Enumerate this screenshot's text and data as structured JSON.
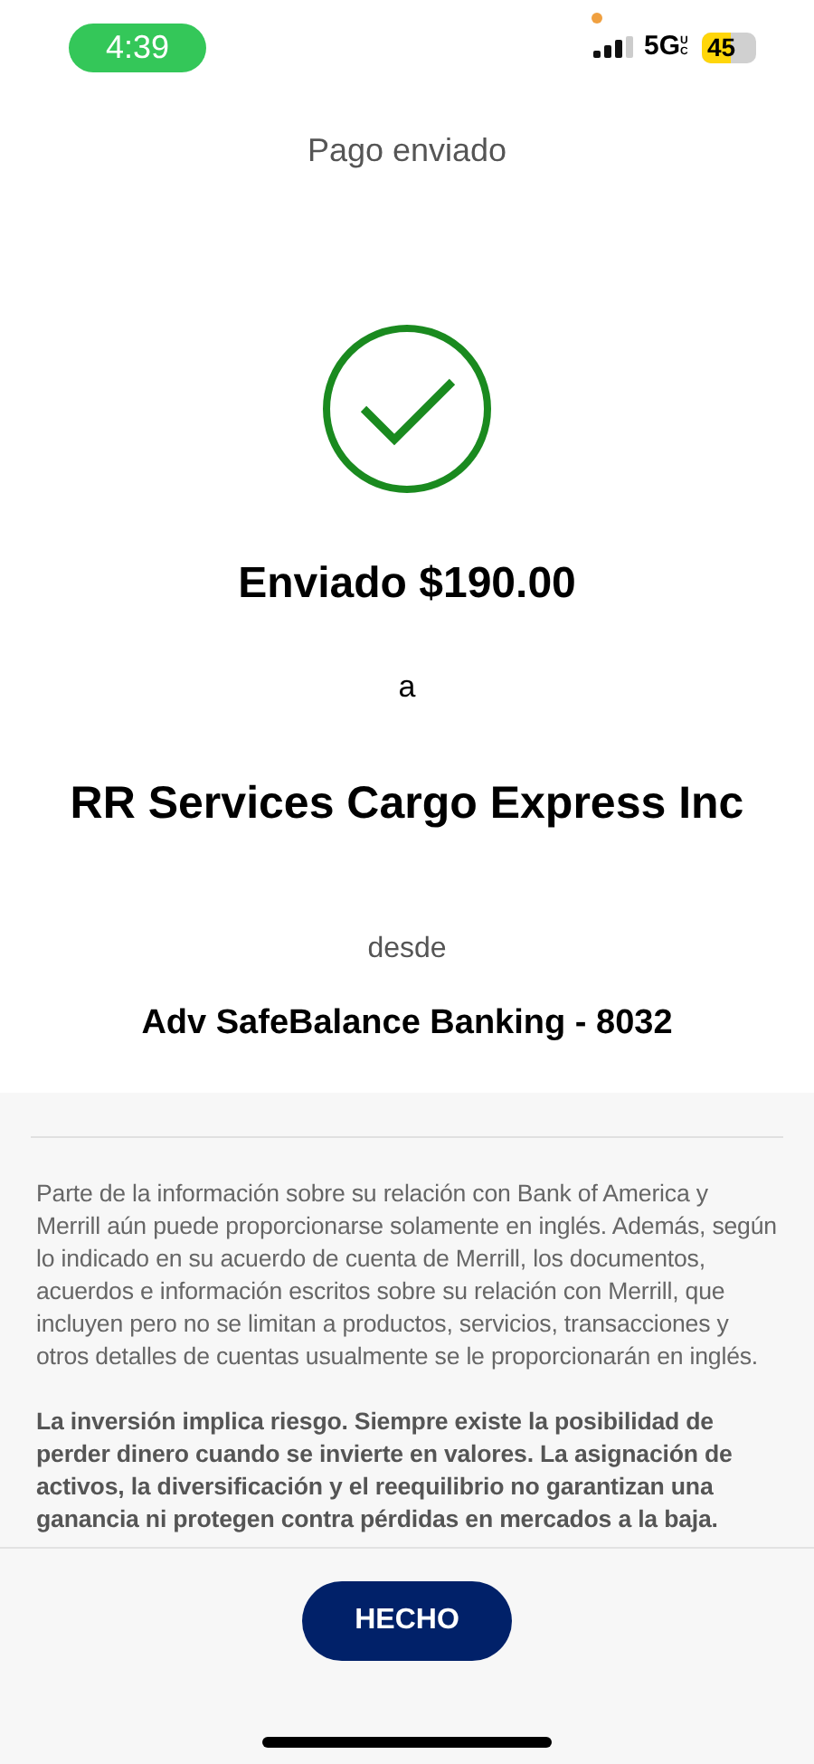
{
  "status_bar": {
    "time": "4:39",
    "network": "5G",
    "network_suffix": "UC",
    "battery": "45"
  },
  "header": {
    "title": "Pago enviado"
  },
  "confirmation": {
    "amount_line": "Enviado $190.00",
    "to_word": "a",
    "recipient": "RR Services Cargo Express Inc",
    "from_word": "desde",
    "account": "Adv SafeBalance Banking - 8032"
  },
  "disclaimers": [
    {
      "kind": "normal",
      "text": "Parte de la información sobre su relación con Bank of America y Merrill aún puede proporcionarse solamente en inglés. Además, según lo indicado en su acuerdo de cuenta de Merrill, los documentos, acuerdos e información escritos sobre su relación con Merrill, que incluyen pero no se limitan a productos, servicios, transacciones y otros detalles de cuentas usualmente se le proporcionarán en inglés."
    },
    {
      "kind": "bold",
      "text": "La inversión implica riesgo. Siempre existe la posibilidad de perder dinero cuando se invierte en valores. La asignación de activos, la diversificación y el reequilibrio no garantizan una ganancia ni protegen contra pérdidas en mercados a la baja."
    }
  ],
  "done_button": {
    "label": "HECHO"
  }
}
